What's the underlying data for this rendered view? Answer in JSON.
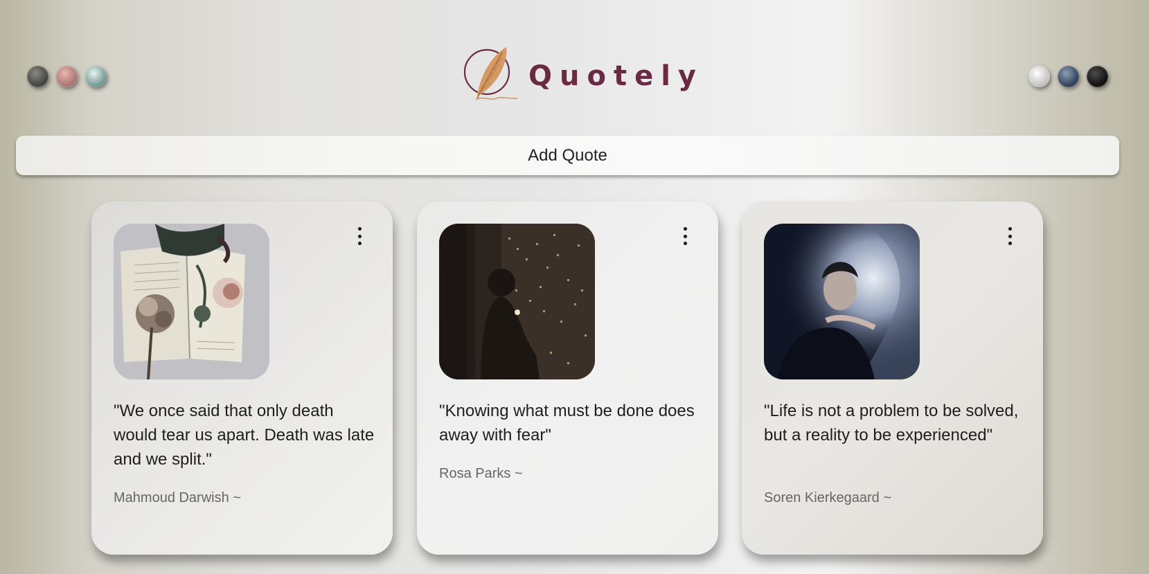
{
  "app": {
    "brand_name": "Quotely",
    "brand_color": "#6b2a44",
    "logo_icon": "feather-quill-icon"
  },
  "theme_swatches": {
    "left": [
      {
        "name": "dark-olive",
        "color": "#4f504b"
      },
      {
        "name": "dusty-rose",
        "color": "#c28f8a"
      },
      {
        "name": "sea-glass",
        "color": "#a9c8c3"
      }
    ],
    "right": [
      {
        "name": "white",
        "color": "#e9e9e9"
      },
      {
        "name": "navy",
        "color": "#3e4e68"
      },
      {
        "name": "black",
        "color": "#1c1c1c"
      }
    ]
  },
  "actions": {
    "add_quote_label": "Add Quote"
  },
  "quotes": [
    {
      "text": "\"We once said that only death would tear us apart. Death was late and we split.\"",
      "author": "Mahmoud Darwish ~",
      "photo": "book-with-pressed-flowers",
      "menu_icon": "more-vertical-icon"
    },
    {
      "text": "\"Knowing what must be done does away with fear\"",
      "author": "Rosa Parks ~",
      "photo": "silhouette-by-night-window",
      "menu_icon": "more-vertical-icon"
    },
    {
      "text": "\"Life is not a problem to be solved, but a reality to be experienced\"",
      "author": "Soren Kierkegaard ~",
      "photo": "man-in-water-splash",
      "menu_icon": "more-vertical-icon"
    }
  ]
}
